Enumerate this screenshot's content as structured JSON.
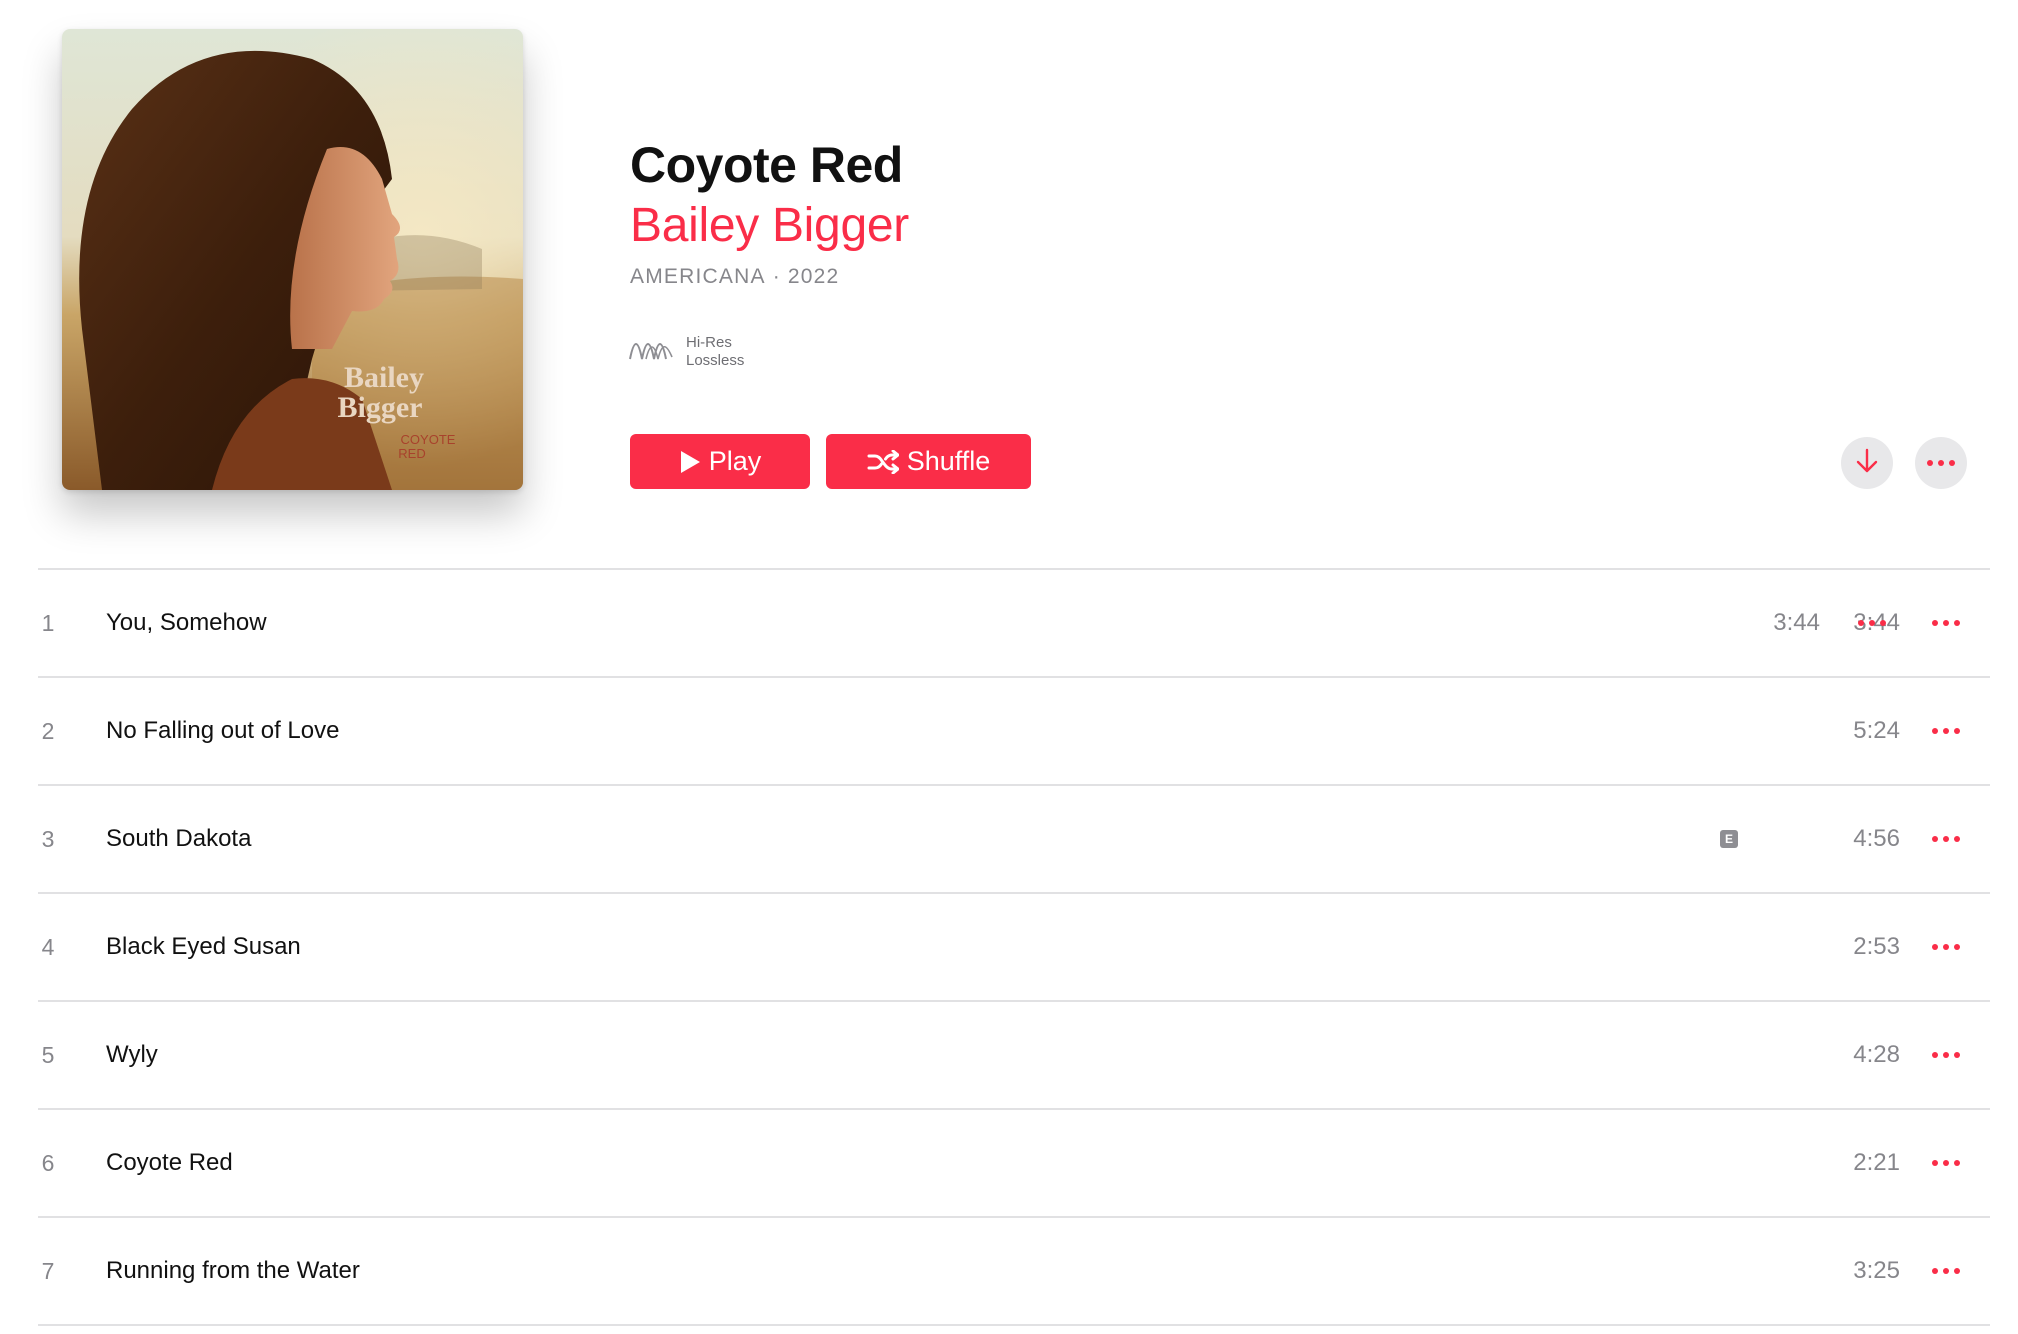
{
  "album": {
    "title": "Coyote Red",
    "artist": "Bailey Bigger",
    "genre": "AMERICANA",
    "separator": " · ",
    "year": "2022",
    "quality_line1": "Hi-Res",
    "quality_line2": "Lossless",
    "artwork_text_line1": "Bailey",
    "artwork_text_line2": "Bigger",
    "artwork_text_line3": "COYOTE",
    "artwork_text_line4": "RED"
  },
  "actions": {
    "play_label": "Play",
    "shuffle_label": "Shuffle",
    "download_icon": "download-arrow-icon",
    "more_icon": "ellipsis-icon"
  },
  "colors": {
    "accent": "#fa2d48",
    "secondary_text": "#86868b",
    "divider": "#e1e1e3"
  },
  "tracks": [
    {
      "number": "1",
      "title": "You, Somehow",
      "duration": "3:44",
      "duration_extra": "3:44",
      "explicit": false
    },
    {
      "number": "2",
      "title": "No Falling out of Love",
      "duration": "5:24",
      "explicit": false
    },
    {
      "number": "3",
      "title": "South Dakota",
      "duration": "4:56",
      "explicit": true,
      "explicit_label": "E"
    },
    {
      "number": "4",
      "title": "Black Eyed Susan",
      "duration": "2:53",
      "explicit": false
    },
    {
      "number": "5",
      "title": "Wyly",
      "duration": "4:28",
      "explicit": false
    },
    {
      "number": "6",
      "title": "Coyote Red",
      "duration": "2:21",
      "explicit": false
    },
    {
      "number": "7",
      "title": "Running from the Water",
      "duration": "3:25",
      "explicit": false
    }
  ]
}
